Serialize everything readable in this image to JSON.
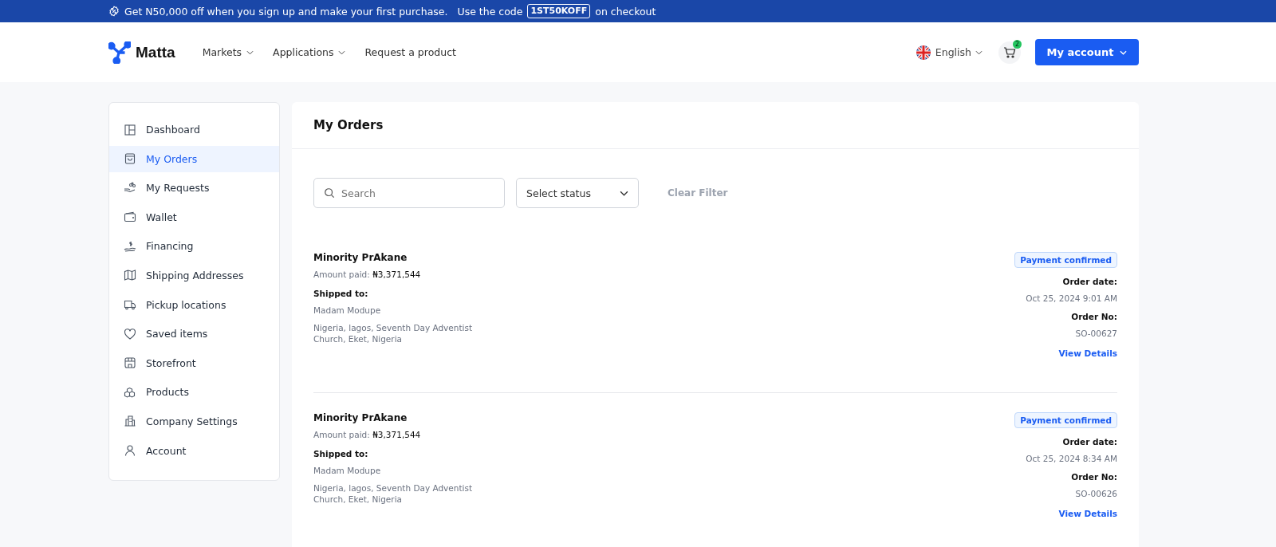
{
  "promo_banner": {
    "text": "Get N50,000 off when you sign up and make your first purchase.",
    "code_prefix": "Use the code",
    "code": "1ST50KOFF",
    "code_suffix": "on checkout"
  },
  "header": {
    "logo": "Matta",
    "nav": [
      {
        "label": "Markets",
        "kind": "dropdown"
      },
      {
        "label": "Applications",
        "kind": "dropdown"
      },
      {
        "label": "Request a product",
        "kind": "link"
      }
    ],
    "language": "English",
    "cart_count": "2",
    "account_button": "My account"
  },
  "sidebar": {
    "items": [
      {
        "label": "Dashboard",
        "selected": false
      },
      {
        "label": "My Orders",
        "selected": true
      },
      {
        "label": "My Requests",
        "selected": false
      },
      {
        "label": "Wallet",
        "selected": false
      },
      {
        "label": "Financing",
        "selected": false
      },
      {
        "label": "Shipping Addresses",
        "selected": false
      },
      {
        "label": "Pickup locations",
        "selected": false
      },
      {
        "label": "Saved items",
        "selected": false
      },
      {
        "label": "Storefront",
        "selected": false
      },
      {
        "label": "Products",
        "selected": false
      },
      {
        "label": "Company Settings",
        "selected": false
      },
      {
        "label": "Account",
        "selected": false
      }
    ]
  },
  "main": {
    "title": "My Orders",
    "search": {
      "placeholder": "Search"
    },
    "status_select": {
      "placeholder": "Select status"
    },
    "clear_filter": "Clear Filter",
    "orders": [
      {
        "name": "Minority PrAkane",
        "amount": "Amount paid: **₦3,371,544**",
        "shipped_label": "Shipped to:",
        "recipient": "Madam Modupe",
        "address": "Nigeria, lagos, Seventh Day Adventist Church, Eket, Nigeria",
        "status": "Payment confirmed",
        "date_label": "Order date:",
        "date": "Oct 25, 2024 9:01 AM",
        "number_label": "Order No:",
        "number": "SO-00627",
        "link": "View Details"
      },
      {
        "name": "Minority PrAkane",
        "amount": "Amount paid: **₦3,371,544**",
        "shipped_label": "Shipped to:",
        "recipient": "Madam Modupe",
        "address": "Nigeria, lagos, Seventh Day Adventist Church, Eket, Nigeria",
        "status": "Payment confirmed",
        "date_label": "Order date:",
        "date": "Oct 25, 2024 8:34 AM",
        "number_label": "Order No:",
        "number": "SO-00626",
        "link": "View Details"
      }
    ]
  }
}
